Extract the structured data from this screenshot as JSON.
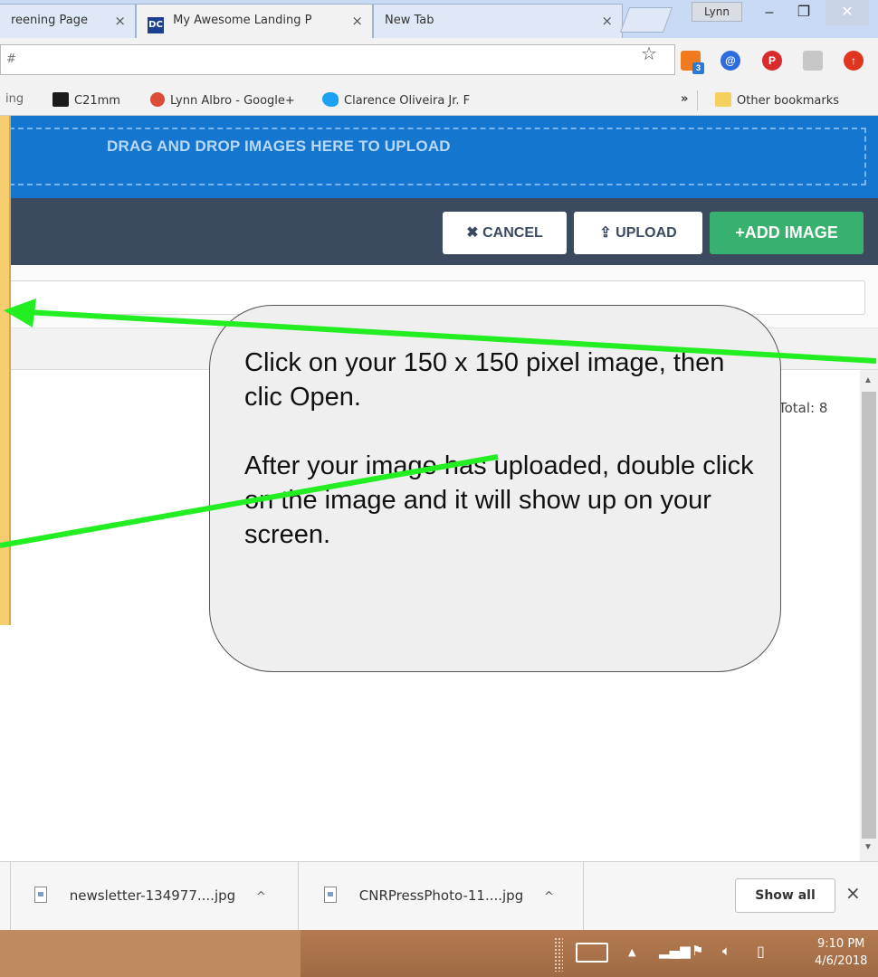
{
  "browser": {
    "tabs": [
      {
        "title": "reening Page",
        "close": "×"
      },
      {
        "title": "My Awesome Landing P",
        "close": "×",
        "favicon": "DC"
      },
      {
        "title": "New Tab",
        "close": "×"
      }
    ],
    "user": "Lynn",
    "window": {
      "minimize": "–",
      "restore": "❐",
      "close": "✕"
    },
    "address": "#",
    "bookmarks": [
      {
        "label": "ing"
      },
      {
        "label": "C21mm"
      },
      {
        "label": "Lynn Albro - Google+"
      },
      {
        "label": "Clarence Oliveira Jr. F"
      },
      {
        "label": "»"
      },
      {
        "label": "Other bookmarks"
      }
    ],
    "extensions": {
      "hubspot_badge": "3"
    }
  },
  "page": {
    "dropzone_text": "DRAG AND DROP IMAGES HERE TO UPLOAD",
    "cancel_label": "CANCEL",
    "upload_label": "UPLOAD",
    "add_label": "ADD IMAGE",
    "total_text": "Total: 8"
  },
  "annotation": {
    "paragraph1": "Click on your 150 x 150 pixel image, then clic Open.",
    "paragraph2": "After your image has uploaded, double click on the image and it will show up on your screen.",
    "arrow_color": "#22ee22"
  },
  "downloads": {
    "items": [
      {
        "name": "newsletter-134977....jpg"
      },
      {
        "name": "CNRPressPhoto-11....jpg"
      }
    ],
    "show_all": "Show all",
    "close": "×"
  },
  "taskbar": {
    "time": "9:10 PM",
    "date": "4/6/2018"
  }
}
